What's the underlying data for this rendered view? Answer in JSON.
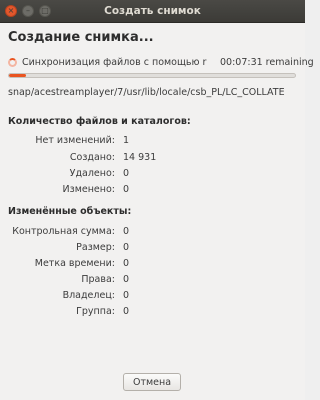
{
  "window": {
    "title": "Создать снимок",
    "controls": {
      "close": "×",
      "minimize": "–",
      "maximize": "□"
    }
  },
  "heading": "Создание снимка...",
  "status": {
    "text": "Синхронизация файлов с помощью rsync",
    "time": "00:07:31 remaining"
  },
  "progress": {
    "fraction": 0.06
  },
  "current_path": "snap/acestreamplayer/7/usr/lib/locale/csb_PL/LC_COLLATE",
  "files_section": {
    "title": "Количество файлов и каталогов:",
    "rows": [
      {
        "label": "Нет изменений:",
        "value": "1"
      },
      {
        "label": "Создано:",
        "value": "14 931"
      },
      {
        "label": "Удалено:",
        "value": "0"
      },
      {
        "label": "Изменено:",
        "value": "0"
      }
    ]
  },
  "changed_section": {
    "title": "Изменённые объекты:",
    "rows": [
      {
        "label": "Контрольная сумма:",
        "value": "0"
      },
      {
        "label": "Размер:",
        "value": "0"
      },
      {
        "label": "Метка времени:",
        "value": "0"
      },
      {
        "label": "Права:",
        "value": "0"
      },
      {
        "label": "Владелец:",
        "value": "0"
      },
      {
        "label": "Группа:",
        "value": "0"
      }
    ]
  },
  "buttons": {
    "cancel": "Отмена"
  },
  "colors": {
    "accent": "#e95420",
    "titlebar": "#3c3b37",
    "background": "#f2f1f0"
  }
}
